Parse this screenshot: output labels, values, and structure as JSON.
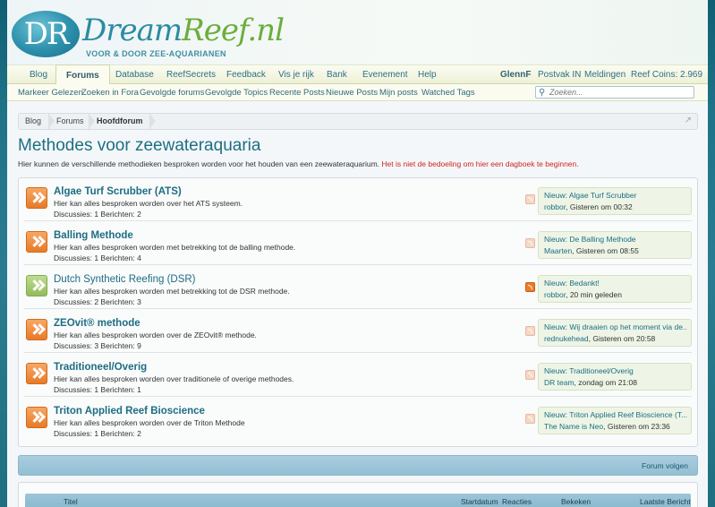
{
  "header": {
    "logo_mark": "DR",
    "logo_name_a": "Dream",
    "logo_name_b": "Reef.nl",
    "logo_tagline": "VOOR & DOOR ZEE-AQUARIANEN"
  },
  "nav": {
    "items": [
      "Blog",
      "Forums",
      "Database",
      "ReefSecrets",
      "Feedback",
      "Vis je rijk",
      "Bank",
      "Evenement",
      "Help"
    ],
    "active": "Forums",
    "user": "GlennF",
    "postvak": "Postvak IN",
    "meldingen": "Meldingen",
    "coins": "Reef Coins: 2.969"
  },
  "subnav": {
    "items": [
      "Markeer Gelezen",
      "Zoeken in Fora",
      "Gevolgde forums",
      "Gevolgde Topics",
      "Recente Posts",
      "Nieuwe Posts",
      "Mijn posts",
      "Watched Tags"
    ]
  },
  "search": {
    "placeholder": "Zoeken..."
  },
  "breadcrumb": [
    "Blog",
    "Forums",
    "Hoofdforum"
  ],
  "page": {
    "title": "Methodes voor zeewateraquaria",
    "description": "Hier kunnen de verschillende methodieken besproken worden voor het houden van een zeewateraquarium.",
    "warning": "Het is niet de bedoeling om hier een dagboek te beginnen."
  },
  "forums": [
    {
      "title": "Algae Turf Scrubber (ATS)",
      "description": "Hier kan alles besproken worden over het ATS systeem.",
      "stats": "Discussies: 1 Berichten: 2",
      "unread": true,
      "last_post_title": "Nieuw: Algae Turf Scrubber",
      "last_post_user": "robbor",
      "last_post_time": ", Gisteren om 00:32"
    },
    {
      "title": "Balling Methode",
      "description": "Hier kan alles besproken worden met betrekking tot de balling methode.",
      "stats": "Discussies: 1 Berichten: 4",
      "unread": true,
      "last_post_title": "Nieuw: De Balling Methode",
      "last_post_user": "Maarten",
      "last_post_time": ", Gisteren om 08:55"
    },
    {
      "title": "Dutch Synthetic Reefing (DSR)",
      "description": "Hier kan alles besproken worden met betrekking tot de DSR methode.",
      "stats": "Discussies: 2 Berichten: 3",
      "unread": false,
      "last_post_title": "Nieuw: Bedankt!",
      "last_post_user": "robbor",
      "last_post_time": ", 20 min geleden"
    },
    {
      "title": "ZEOvit® methode",
      "description": "Hier kan alles besproken worden over de ZEOvit® methode.",
      "stats": "Discussies: 3 Berichten: 9",
      "unread": true,
      "last_post_title": "Nieuw: Wij draaien op het moment via de...",
      "last_post_user": "rednukehead",
      "last_post_time": ", Gisteren om 20:58"
    },
    {
      "title": "Traditioneel/Overig",
      "description": "Hier kan alles besproken worden over traditionele of overige methodes.",
      "stats": "Discussies: 1 Berichten: 1",
      "unread": true,
      "last_post_title": "Nieuw: Traditioneel/Overig",
      "last_post_user": "DR team",
      "last_post_time": ", zondag om 21:08"
    },
    {
      "title": "Triton Applied Reef Bioscience",
      "description": "Hier kan alles besproken worden over de Triton Methode",
      "stats": "Discussies: 1 Berichten: 2",
      "unread": true,
      "last_post_title": "Nieuw: Triton Applied Reef Bioscience (T...",
      "last_post_user": "The Name is Neo",
      "last_post_time": ", Gisteren om 23:36"
    }
  ],
  "follow_bar": {
    "label": "Forum volgen"
  },
  "thread_columns": [
    "Titel",
    "Startdatum",
    "Reacties",
    "Bekeken",
    "Laatste Bericht"
  ],
  "colors": {
    "accent": "#1d6d83",
    "unread_icon": "#e87a27",
    "read_icon": "#93bb5a",
    "warning": "#d02323"
  }
}
